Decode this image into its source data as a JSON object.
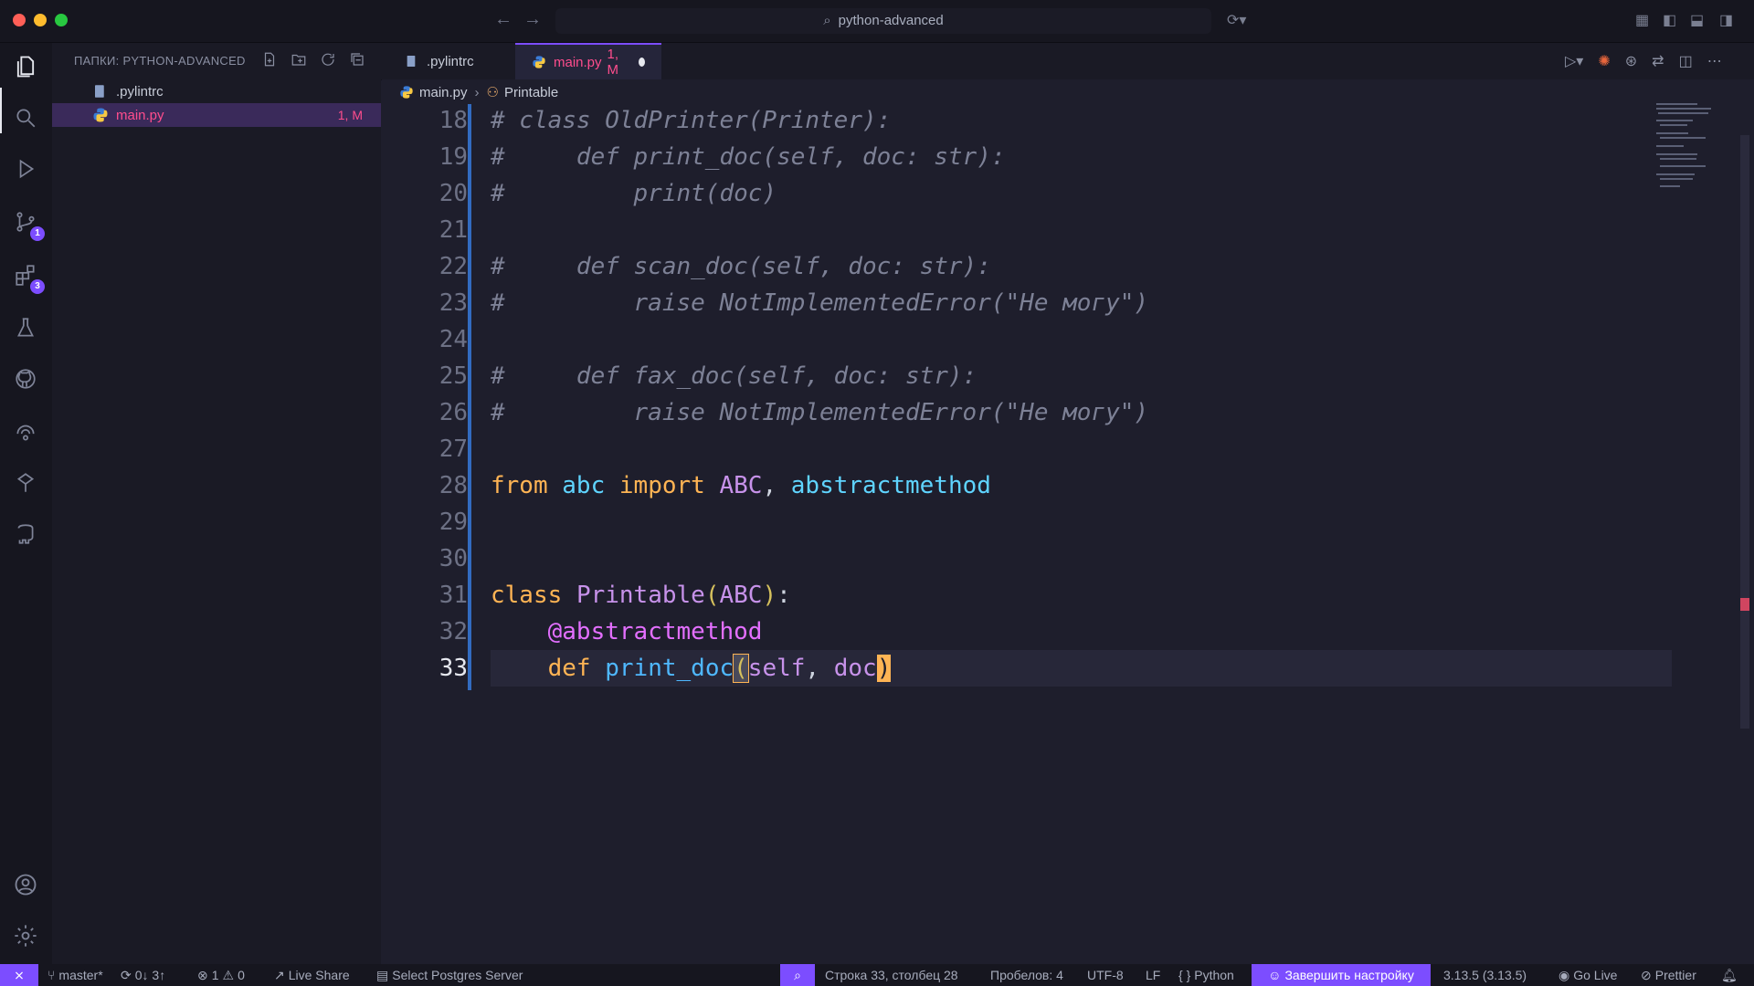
{
  "titlebar": {
    "search": "python-advanced"
  },
  "sidebar": {
    "header": "ПАПКИ: PYTHON-ADVANCED",
    "files": [
      {
        "name": ".pylintrc",
        "status": ""
      },
      {
        "name": "main.py",
        "status": "1, M"
      }
    ]
  },
  "tabs": [
    {
      "label": ".pylintrc",
      "status": ""
    },
    {
      "label": "main.py",
      "status": "1, M"
    }
  ],
  "breadcrumb": {
    "file": "main.py",
    "symbol": "Printable"
  },
  "activity_badges": {
    "source_control": "1",
    "extensions": "3"
  },
  "editor": {
    "line_numbers": [
      "18",
      "19",
      "20",
      "21",
      "22",
      "23",
      "24",
      "25",
      "26",
      "27",
      "28",
      "29",
      "30",
      "31",
      "32",
      "33"
    ],
    "current_line": "33",
    "code": {
      "l18": "# class OldPrinter(Printer):",
      "l19": "#     def print_doc(self, doc: str):",
      "l20": "#         print(doc)",
      "l22": "#     def scan_doc(self, doc: str):",
      "l23": "#         raise NotImplementedError(\"Не могу\")",
      "l25": "#     def fax_doc(self, doc: str):",
      "l26": "#         raise NotImplementedError(\"Не могу\")",
      "l28_from": "from",
      "l28_mod": "abc",
      "l28_import": "import",
      "l28_abc": "ABC",
      "l28_comma": ", ",
      "l28_am": "abstractmethod",
      "l31_class": "class",
      "l31_name": "Printable",
      "l31_open": "(",
      "l31_base": "ABC",
      "l31_close": ")",
      "l31_colon": ":",
      "l32_dec": "@abstractmethod",
      "l33_def": "def",
      "l33_fn": "print_doc",
      "l33_open": "(",
      "l33_self": "self",
      "l33_comma": ", ",
      "l33_doc": "doc",
      "l33_close": ")"
    }
  },
  "statusbar": {
    "branch": "master*",
    "sync": "0↓ 3↑",
    "errors": "1",
    "warnings": "0",
    "live_share": "Live Share",
    "postgres": "Select Postgres Server",
    "position": "Строка 33, столбец 28",
    "spaces": "Пробелов: 4",
    "encoding": "UTF-8",
    "eol": "LF",
    "language": "Python",
    "setup": "Завершить настройку",
    "python_version": "3.13.5 (3.13.5)",
    "go_live": "Go Live",
    "prettier": "Prettier"
  },
  "colors": {
    "accent": "#7c4dff",
    "modified": "#ff4d8d",
    "keyword": "#ffb454"
  }
}
